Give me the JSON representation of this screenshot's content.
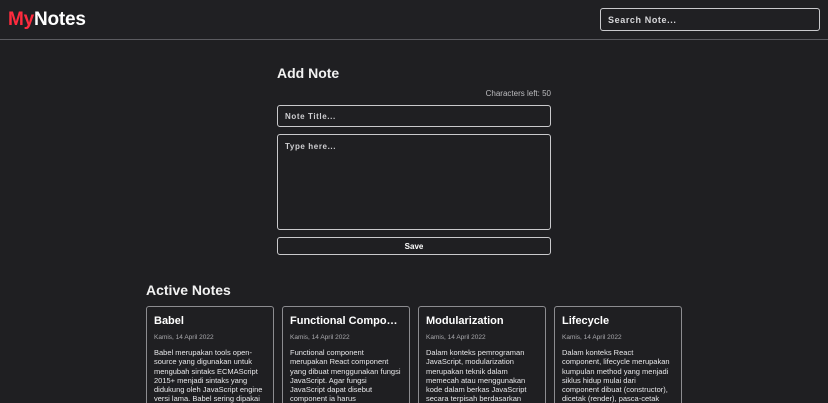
{
  "header": {
    "brand_accent": "My",
    "brand_rest": "Notes",
    "search_placeholder": "Search Note..."
  },
  "add_note": {
    "heading": "Add Note",
    "char_counter": "Characters left: 50",
    "title_placeholder": "Note Title...",
    "body_placeholder": "Type here...",
    "save_label": "Save"
  },
  "active_notes": {
    "heading": "Active Notes",
    "notes": [
      {
        "title": "Babel",
        "date": "Kamis, 14 April 2022",
        "body": "Babel merupakan tools open-source yang digunakan untuk mengubah sintaks ECMAScript 2015+ menjadi sintaks yang didukung oleh JavaScript engine versi lama. Babel sering dipakai ketika kita"
      },
      {
        "title": "Functional Component",
        "date": "Kamis, 14 April 2022",
        "body": "Functional component merupakan React component yang dibuat menggunakan fungsi JavaScript. Agar fungsi JavaScript dapat disebut component ia harus mengembalikan React element"
      },
      {
        "title": "Modularization",
        "date": "Kamis, 14 April 2022",
        "body": "Dalam konteks pemrograman JavaScript, modularization merupakan teknik dalam memecah atau menggunakan kode dalam berkas JavaScript secara terpisah berdasarkan tanggung jawabnya masing-"
      },
      {
        "title": "Lifecycle",
        "date": "Kamis, 14 April 2022",
        "body": "Dalam konteks React component, lifecycle merupakan kumpulan method yang menjadi siklus hidup mulai dari component dibuat (constructor), dicetak (render), pasca-cetak"
      }
    ]
  },
  "colors": {
    "background": "#1f1f22",
    "brand_accent": "#ff2b3e",
    "border": "#c9c9cc"
  }
}
